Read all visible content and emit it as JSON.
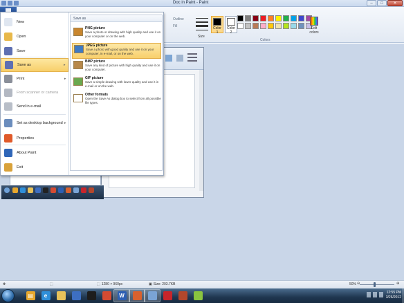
{
  "window": {
    "title": "Doc in Paint - Paint"
  },
  "window_controls": {
    "minimize": "–",
    "maximize": "□",
    "close": "✕"
  },
  "ribbon": {
    "outline_label": "Outline",
    "fill_label": "Fill",
    "size_label": "Size",
    "color1_label": "Color 1",
    "color2_label": "Color 2",
    "edit_colors_label": "Edit colors",
    "colors_group_label": "Colors",
    "color1": "#000000",
    "color2": "#ffffff",
    "palette": [
      "#000000",
      "#7f7f7f",
      "#880015",
      "#ed1c24",
      "#ff7f27",
      "#fff200",
      "#22b14c",
      "#00a2e8",
      "#3f48cc",
      "#a349a4",
      "#ffffff",
      "#c3c3c3",
      "#b97a57",
      "#ffaec9",
      "#ffc90e",
      "#efe4b0",
      "#b5e61d",
      "#99d9ea",
      "#7092be",
      "#c8bfe7"
    ]
  },
  "app_menu": {
    "items": [
      {
        "label": "New",
        "icon": "new-document-icon",
        "color": "#dfe6f0"
      },
      {
        "label": "Open",
        "icon": "open-folder-icon",
        "color": "#e8b84a"
      },
      {
        "label": "Save",
        "icon": "save-disk-icon",
        "color": "#5d6fb2"
      },
      {
        "label": "Save as",
        "icon": "save-as-icon",
        "color": "#5d6fb2",
        "arrow": "▸"
      },
      {
        "label": "Print",
        "icon": "printer-icon",
        "color": "#8a8f99",
        "arrow": "▸"
      },
      {
        "label": "From scanner or camera",
        "icon": "scanner-icon",
        "color": "#b3b8c2"
      },
      {
        "label": "Send in e-mail",
        "icon": "email-icon",
        "color": "#b8bec8"
      },
      {
        "label": "Set as desktop background",
        "icon": "desktop-background-icon",
        "color": "#6b8dbd",
        "arrow": "▸"
      },
      {
        "label": "Properties",
        "icon": "properties-check-icon",
        "color": "#e05a2a"
      },
      {
        "label": "About Paint",
        "icon": "about-info-icon",
        "color": "#2f66b8"
      },
      {
        "label": "Exit",
        "icon": "exit-icon",
        "color": "#d9a23a"
      }
    ],
    "save_as_header": "Save as",
    "save_as_options": [
      {
        "title": "PNG picture",
        "desc": "Save a photo or drawing with high quality and use it on your computer or on the web.",
        "icon": "png-picture-icon",
        "color": "#c8862f"
      },
      {
        "title": "JPEG picture",
        "desc": "Save a photo with good quality and use it on your computer, in e-mail, or on the web.",
        "icon": "jpeg-picture-icon",
        "color": "#3f7ac2"
      },
      {
        "title": "BMP picture",
        "desc": "Save any kind of picture with high quality and use it on your computer.",
        "icon": "bmp-picture-icon",
        "color": "#b7884a"
      },
      {
        "title": "GIF picture",
        "desc": "Save a simple drawing with lower quality and use it in e-mail or on the web.",
        "icon": "gif-picture-icon",
        "color": "#6aa84f"
      },
      {
        "title": "Other formats",
        "desc": "Open the Save As dialog box to select from all possible file types.",
        "icon": "other-formats-icon",
        "color": "#ffffff"
      }
    ]
  },
  "statusbar": {
    "dimensions": "1280 × 960px",
    "size": "Size: 203.7KB",
    "zoom": "50%",
    "zoom_fraction": 0.5
  },
  "taskbar": {
    "time": "12:55 PM",
    "date": "3/26/2012",
    "apps": [
      {
        "name": "taskbar-windows-explorer-icon",
        "color": "#e7a82e",
        "glyph": "▤"
      },
      {
        "name": "taskbar-internet-explorer-icon",
        "color": "#2f8fd9",
        "glyph": "e"
      },
      {
        "name": "taskbar-folder-icon",
        "color": "#e8c25a",
        "glyph": ""
      },
      {
        "name": "taskbar-media-icon",
        "color": "#3d6fc2",
        "glyph": ""
      },
      {
        "name": "taskbar-qq-icon",
        "color": "#1d1d1d",
        "glyph": ""
      },
      {
        "name": "taskbar-chrome-icon",
        "color": "#d44b32",
        "glyph": ""
      },
      {
        "name": "taskbar-word-icon",
        "color": "#2d5fb3",
        "glyph": "W"
      },
      {
        "name": "taskbar-app-icon",
        "color": "#d8612e",
        "glyph": ""
      },
      {
        "name": "taskbar-paint-icon",
        "color": "#7aa4d6",
        "glyph": ""
      },
      {
        "name": "taskbar-pdf-icon",
        "color": "#c8252b",
        "glyph": ""
      },
      {
        "name": "taskbar-archive-icon",
        "color": "#b3472c",
        "glyph": ""
      },
      {
        "name": "taskbar-picasa-icon",
        "color": "#8ac43f",
        "glyph": ""
      }
    ]
  }
}
